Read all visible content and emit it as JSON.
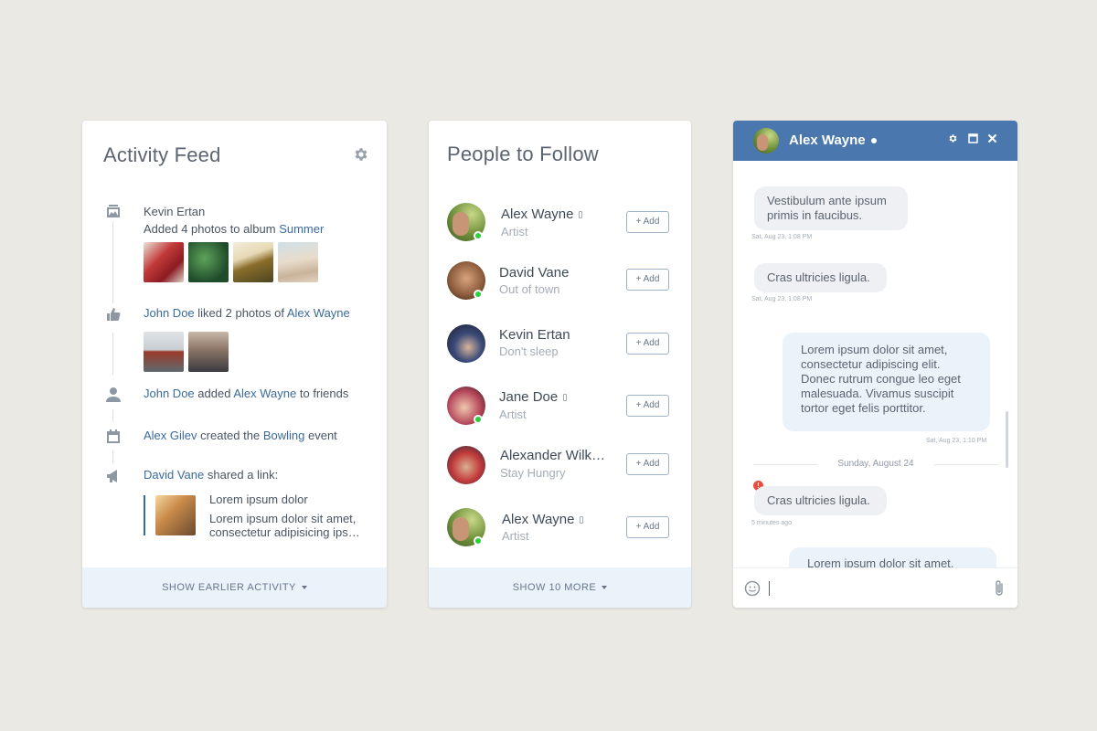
{
  "activity_feed": {
    "title": "Activity Feed",
    "items": [
      {
        "icon": "photo-icon",
        "actor": "Kevin Ertan",
        "text": "Added 4 photos to album",
        "target": "Summer"
      },
      {
        "icon": "thumbs-up-icon",
        "actor": "John Doe",
        "text": "liked 2 photos of",
        "target": "Alex Wayne"
      },
      {
        "icon": "user-icon",
        "actor": "John Doe",
        "text": "added",
        "target": "Alex Wayne",
        "suffix": "to friends"
      },
      {
        "icon": "calendar-icon",
        "actor": "Alex Gilev",
        "text": "created the",
        "target": "Bowling",
        "suffix": "event"
      },
      {
        "icon": "megaphone-icon",
        "actor": "David Vane",
        "text": "shared a link:"
      }
    ],
    "shared_link": {
      "title": "Lorem ipsum dolor",
      "excerpt_line1": "Lorem ipsum dolor sit amet,",
      "excerpt_line2": "consectetur adipisicing ips…"
    },
    "footer": "SHOW EARLIER ACTIVITY"
  },
  "people": {
    "title": "People to Follow",
    "add_label": "+ Add",
    "items": [
      {
        "name": "Alex Wayne",
        "sub": "Artist",
        "online": true,
        "phone": true
      },
      {
        "name": "David Vane",
        "sub": "Out of town",
        "online": true,
        "phone": false
      },
      {
        "name": "Kevin Ertan",
        "sub": "Don't sleep",
        "online": false,
        "phone": false
      },
      {
        "name": "Jane Doe",
        "sub": "Artist",
        "online": true,
        "phone": true
      },
      {
        "name": "Alexander Wilk…",
        "sub": "Stay Hungry",
        "online": false,
        "phone": false
      },
      {
        "name": "Alex Wayne",
        "sub": "Artist",
        "online": true,
        "phone": true
      }
    ],
    "footer": "SHOW 10 MORE"
  },
  "chat": {
    "name": "Alex Wayne",
    "messages": [
      {
        "dir": "in",
        "line1": "Vestibulum ante ipsum",
        "line2": "primis in faucibus.",
        "time": "Sat, Aug 23, 1:08 PM"
      },
      {
        "dir": "in",
        "line1": "Cras ultricies ligula.",
        "time": "Sat, Aug 23, 1:08 PM"
      },
      {
        "dir": "out",
        "lines": [
          "Lorem ipsum dolor sit amet,",
          "consectetur adipiscing elit.",
          "Donec rutrum congue leo eget",
          "malesuada. Vivamus suscipit",
          "tortor eget felis porttitor."
        ],
        "time": "Sat, Aug 23, 1:10 PM"
      },
      {
        "dir": "in",
        "line1": "Cras ultricies ligula.",
        "time": "5 minutes ago",
        "error": true
      },
      {
        "dir": "out",
        "line1": "Lorem ipsum dolor sit amet,"
      }
    ],
    "day_separator": "Sunday, August 24",
    "error_mark": "!",
    "colors": {
      "header": "#4a78ae",
      "online": "#2ecc40",
      "error": "#e74c3c"
    }
  }
}
